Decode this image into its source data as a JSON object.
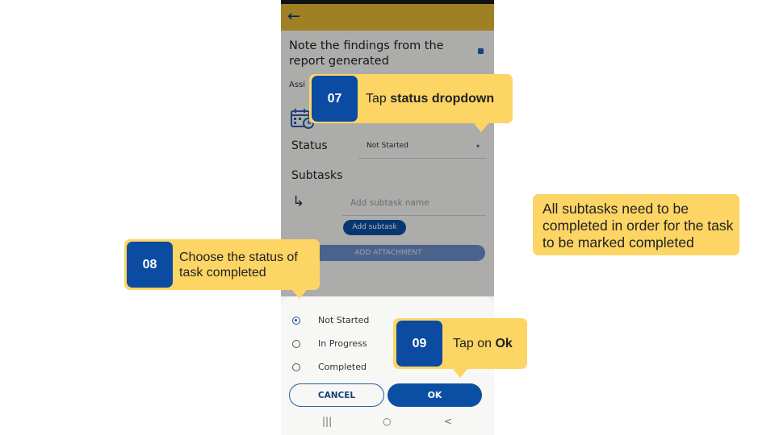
{
  "app": {
    "back_icon": "arrow-left-icon",
    "task_title": "Note the findings from the report generated",
    "assigned_label_partial": "Assi",
    "status_label": "Status",
    "status_value": "Not Started",
    "subtasks_heading": "Subtasks",
    "subtask_placeholder": "Add subtask name",
    "add_subtask_label": "Add subtask",
    "add_attachment_label": "ADD ATTACHMENT",
    "accent_color": "#e4b833",
    "primary_color": "#0b4fa3"
  },
  "status_sheet": {
    "options": [
      {
        "label": "Not Started",
        "selected": true
      },
      {
        "label": "In Progress",
        "selected": false
      },
      {
        "label": "Completed",
        "selected": false
      }
    ],
    "cancel_label": "CANCEL",
    "ok_label": "OK"
  },
  "navbar": {
    "recents": "|||",
    "home": "○",
    "back": "<"
  },
  "callouts": {
    "step07": {
      "number": "07",
      "text_prefix": "Tap ",
      "text_bold": "status dropdown"
    },
    "step08": {
      "number": "08",
      "line1": "Choose the status of",
      "line2": "task completed"
    },
    "step09": {
      "number": "09",
      "text_prefix": "Tap on ",
      "text_bold": "Ok"
    },
    "note": "All subtasks need to be completed in order for the task to be marked completed"
  }
}
